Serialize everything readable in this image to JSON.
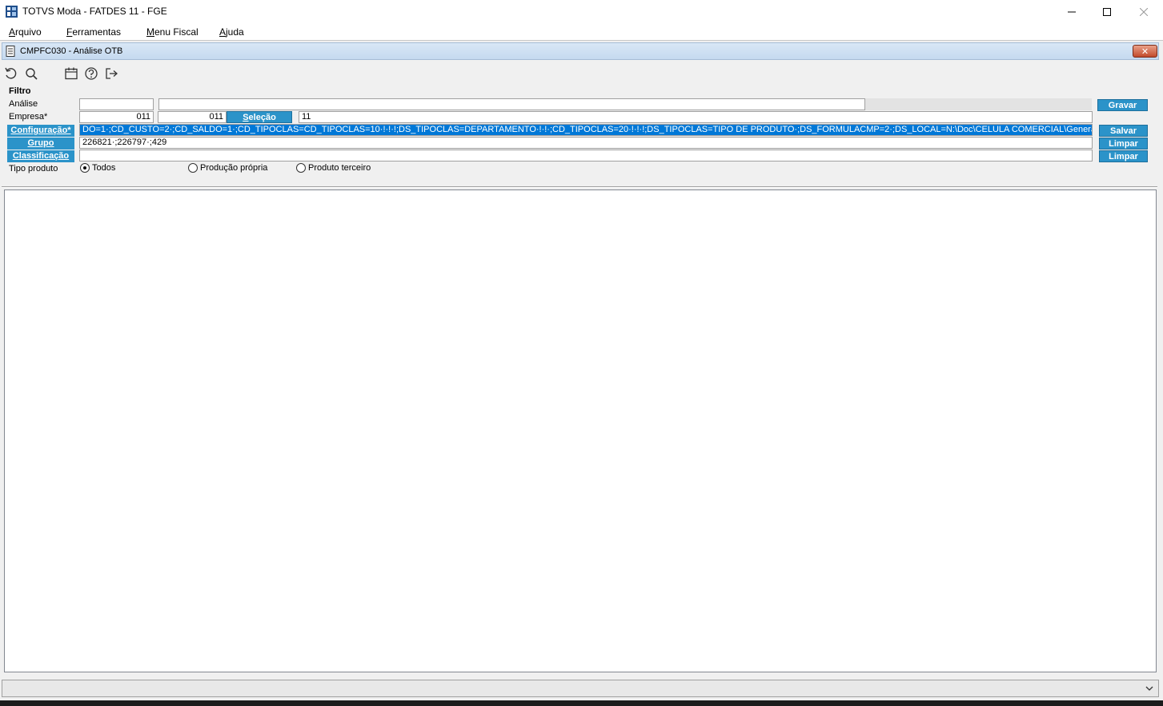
{
  "window": {
    "title": "TOTVS Moda - FATDES 11 - FGE"
  },
  "menu": [
    {
      "underlined": "A",
      "rest": "rquivo"
    },
    {
      "underlined": "F",
      "rest": "erramentas"
    },
    {
      "underlined": "M",
      "rest": "enu Fiscal"
    },
    {
      "underlined": "A",
      "rest": "juda"
    }
  ],
  "child_window": {
    "title": "CMPFC030 - Análise OTB",
    "close_label": "✕"
  },
  "toolbar": {
    "icons": [
      "refresh-icon",
      "search-icon",
      "calendar-icon",
      "help-icon",
      "exit-icon"
    ]
  },
  "filter": {
    "section_label": "Filtro",
    "analise_label": "Análise",
    "analise_code": "",
    "analise_desc": "",
    "empresa_label": "Empresa*",
    "empresa_from": "011",
    "empresa_to": "011",
    "selecao_underlined": "S",
    "selecao_rest": "eleção",
    "selecao_value": "11",
    "configuracao_label": "Configuração*",
    "configuracao_value": "DO=1·;CD_CUSTO=2·;CD_SALDO=1·;CD_TIPOCLAS=CD_TIPOCLAS=10·!·!·!;DS_TIPOCLAS=DEPARTAMENTO·!·!·;CD_TIPOCLAS=20·!·!·!;DS_TIPOCLAS=TIPO DE PRODUTO·;DS_FORMULACMP=2·;DS_LOCAL=N:\\Doc\\CELULA COMERCIAL\\General\\export_otb.csv",
    "grupo_label": "Grupo",
    "grupo_value": "226821·;226797·;429",
    "classificacao_label": "Classificação",
    "classificacao_value": "",
    "tipo_produto_label": "Tipo produto",
    "tipo_options": [
      {
        "label": "Todos",
        "selected": true
      },
      {
        "label": "Produção própria",
        "selected": false
      },
      {
        "label": "Produto terceiro",
        "selected": false
      }
    ]
  },
  "buttons": {
    "gravar": "Gravar",
    "salvar": "Salvar",
    "limpar_grupo": "Limpar",
    "limpar_classificacao": "Limpar"
  },
  "status_bar": {
    "text": ""
  },
  "colors": {
    "accent_button": "#2b93c9",
    "selection": "#0078d7",
    "child_title_gradient": "#c5d9ef"
  }
}
